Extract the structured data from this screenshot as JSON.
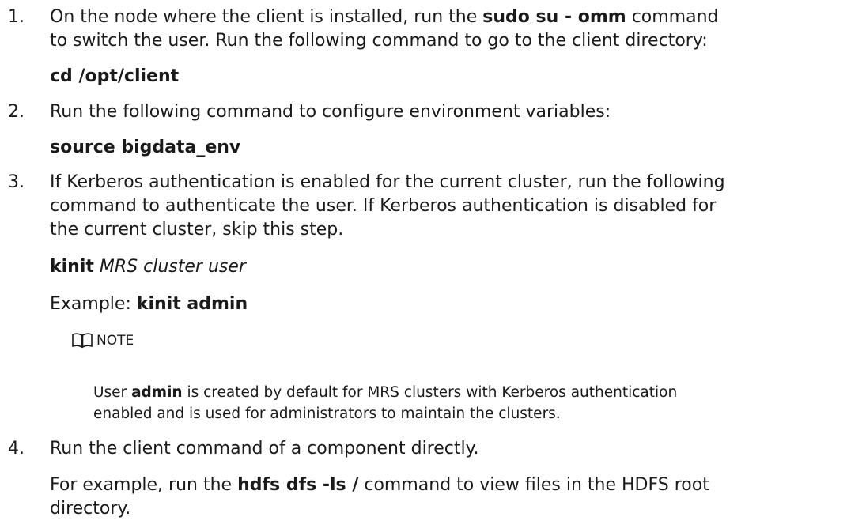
{
  "steps": [
    {
      "number": "1.",
      "line1": {
        "before": "On the node where the client is installed, run the ",
        "bold": "sudo su - omm",
        "after": " command"
      },
      "line2": "to switch the user. Run the following command to go to the client directory:",
      "command": "cd /opt/client"
    },
    {
      "number": "2.",
      "line1": "Run the following command to configure environment variables:",
      "command": "source bigdata_env"
    },
    {
      "number": "3.",
      "lines": [
        "If Kerberos authentication is enabled for the current cluster, run the following",
        "command to authenticate the user. If Kerberos authentication is disabled for",
        "the current cluster, skip this step."
      ],
      "command_bold": "kinit",
      "command_italic": "MRS cluster user",
      "example_label": "Example: ",
      "example_cmd": "kinit admin",
      "note": {
        "label": "NOTE",
        "line1_before": "User ",
        "line1_bold": "admin",
        "line1_after": " is created by default for MRS clusters with Kerberos authentication",
        "line2": "enabled and is used for administrators to maintain the clusters."
      }
    },
    {
      "number": "4.",
      "line1": "Run the client command of a component directly.",
      "line2_before": "For example, run the ",
      "line2_bold": "hdfs dfs -ls /",
      "line2_after": " command to view files in the HDFS root",
      "line3": "directory."
    }
  ]
}
